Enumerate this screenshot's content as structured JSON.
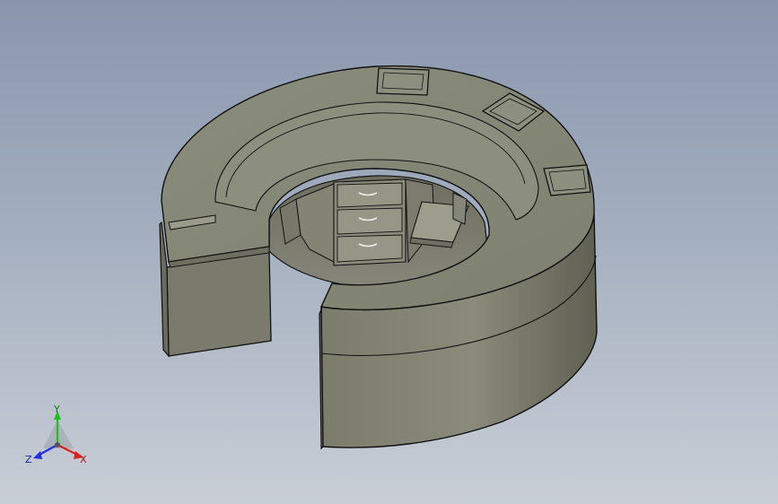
{
  "viewport": {
    "model_name": "",
    "colors": {
      "bg_top": "#8996ad",
      "bg_bottom": "#c9ced6",
      "body": "#7c7d6d",
      "top_surface": "#8a8c7b",
      "edge": "#111111",
      "drawer": "#9a9b8b"
    }
  },
  "triad": {
    "x_label": "X",
    "y_label": "Y",
    "z_label": "Z",
    "x_color": "#e02020",
    "y_color": "#20c020",
    "z_color": "#2030e0"
  }
}
